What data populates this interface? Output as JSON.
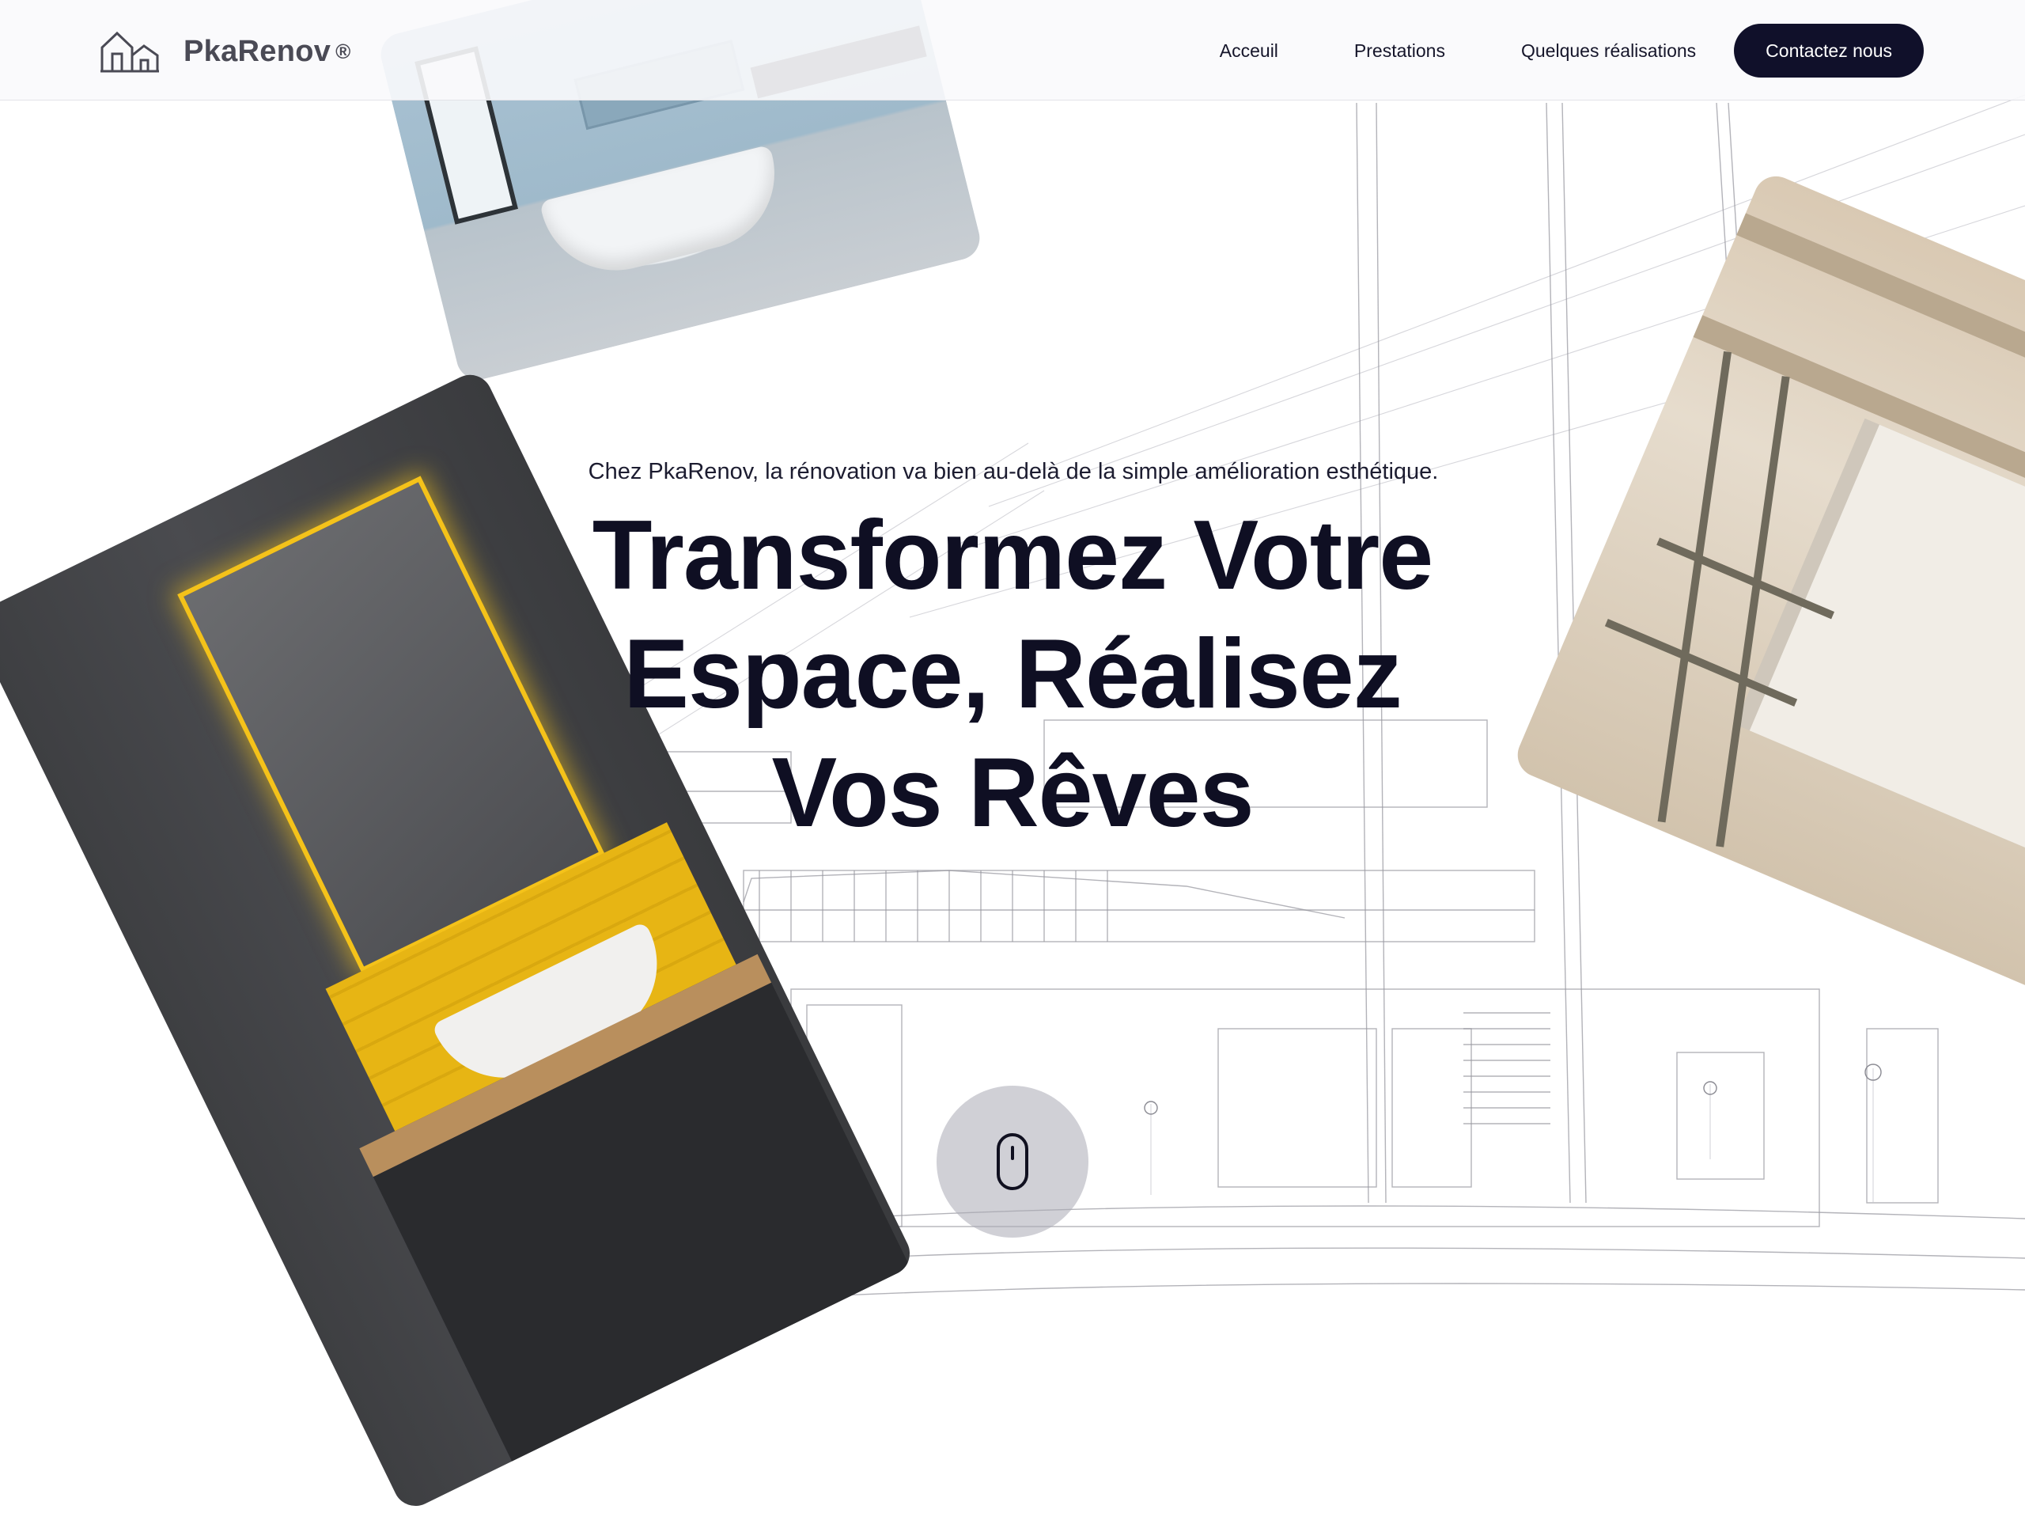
{
  "brand": {
    "name": "PkaRenov",
    "registered_mark": "®",
    "logo_icon": "houses-icon"
  },
  "nav": {
    "items": [
      {
        "label": "Acceuil"
      },
      {
        "label": "Prestations"
      },
      {
        "label": "Quelques réalisations"
      }
    ],
    "cta_label": "Contactez nous"
  },
  "hero": {
    "subtitle": "Chez PkaRenov, la rénovation va bien au-delà de la simple amélioration esthétique.",
    "headline_line1": "Transformez Votre",
    "headline_line2": "Espace, Réalisez",
    "headline_line3": "Vos Rêves"
  },
  "scroll_indicator": {
    "icon": "mouse-scroll-icon"
  },
  "colors": {
    "text_dark": "#0f0f23",
    "cta_bg": "#10102a",
    "cta_text": "#ffffff",
    "accent_yellow": "#f4c21a"
  }
}
